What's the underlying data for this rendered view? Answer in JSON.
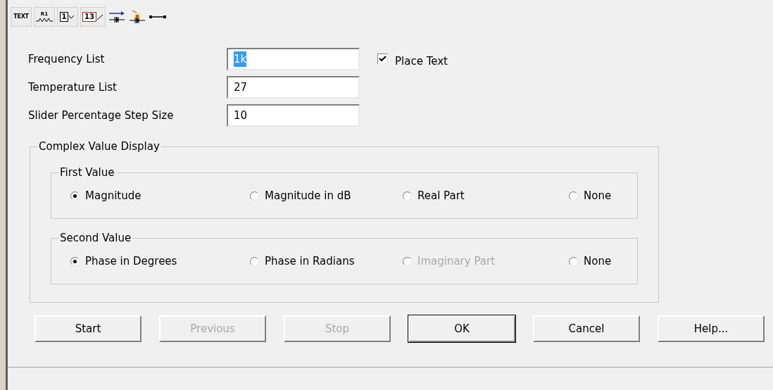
{
  "toolbar": [
    {
      "kind": "text",
      "label": "TEXT"
    },
    {
      "kind": "resistor",
      "label": "R1"
    },
    {
      "kind": "node",
      "label": "1"
    },
    {
      "kind": "node-red",
      "label": "13"
    },
    {
      "kind": "current"
    },
    {
      "kind": "diode-light"
    },
    {
      "kind": "wire"
    }
  ],
  "fields": [
    {
      "label": "Frequency List",
      "value": "1k",
      "highlighted": true
    },
    {
      "label": "Temperature List",
      "value": "27",
      "highlighted": false
    },
    {
      "label": "Slider Percentage Step Size",
      "value": "10",
      "highlighted": false
    }
  ],
  "place_text": {
    "label": "Place Text",
    "checked": true
  },
  "complex": {
    "title": "Complex Value Display",
    "groups": [
      {
        "title": "First Value",
        "options": [
          {
            "label": "Magnitude",
            "selected": true,
            "disabled": false
          },
          {
            "label": "Magnitude in dB",
            "selected": false,
            "disabled": false
          },
          {
            "label": "Real Part",
            "selected": false,
            "disabled": false
          },
          {
            "label": "None",
            "selected": false,
            "disabled": false
          }
        ]
      },
      {
        "title": "Second Value",
        "options": [
          {
            "label": "Phase in Degrees",
            "selected": true,
            "disabled": false
          },
          {
            "label": "Phase in Radians",
            "selected": false,
            "disabled": false
          },
          {
            "label": "Imaginary Part",
            "selected": false,
            "disabled": true
          },
          {
            "label": "None",
            "selected": false,
            "disabled": false
          }
        ]
      }
    ]
  },
  "buttons": [
    {
      "label": "Start",
      "disabled": false,
      "default": false
    },
    {
      "label": "Previous",
      "disabled": true,
      "default": false
    },
    {
      "label": "Stop",
      "disabled": true,
      "default": false
    },
    {
      "label": "OK",
      "disabled": false,
      "default": true
    },
    {
      "label": "Cancel",
      "disabled": false,
      "default": false
    },
    {
      "label": "Help...",
      "disabled": false,
      "default": false
    }
  ]
}
